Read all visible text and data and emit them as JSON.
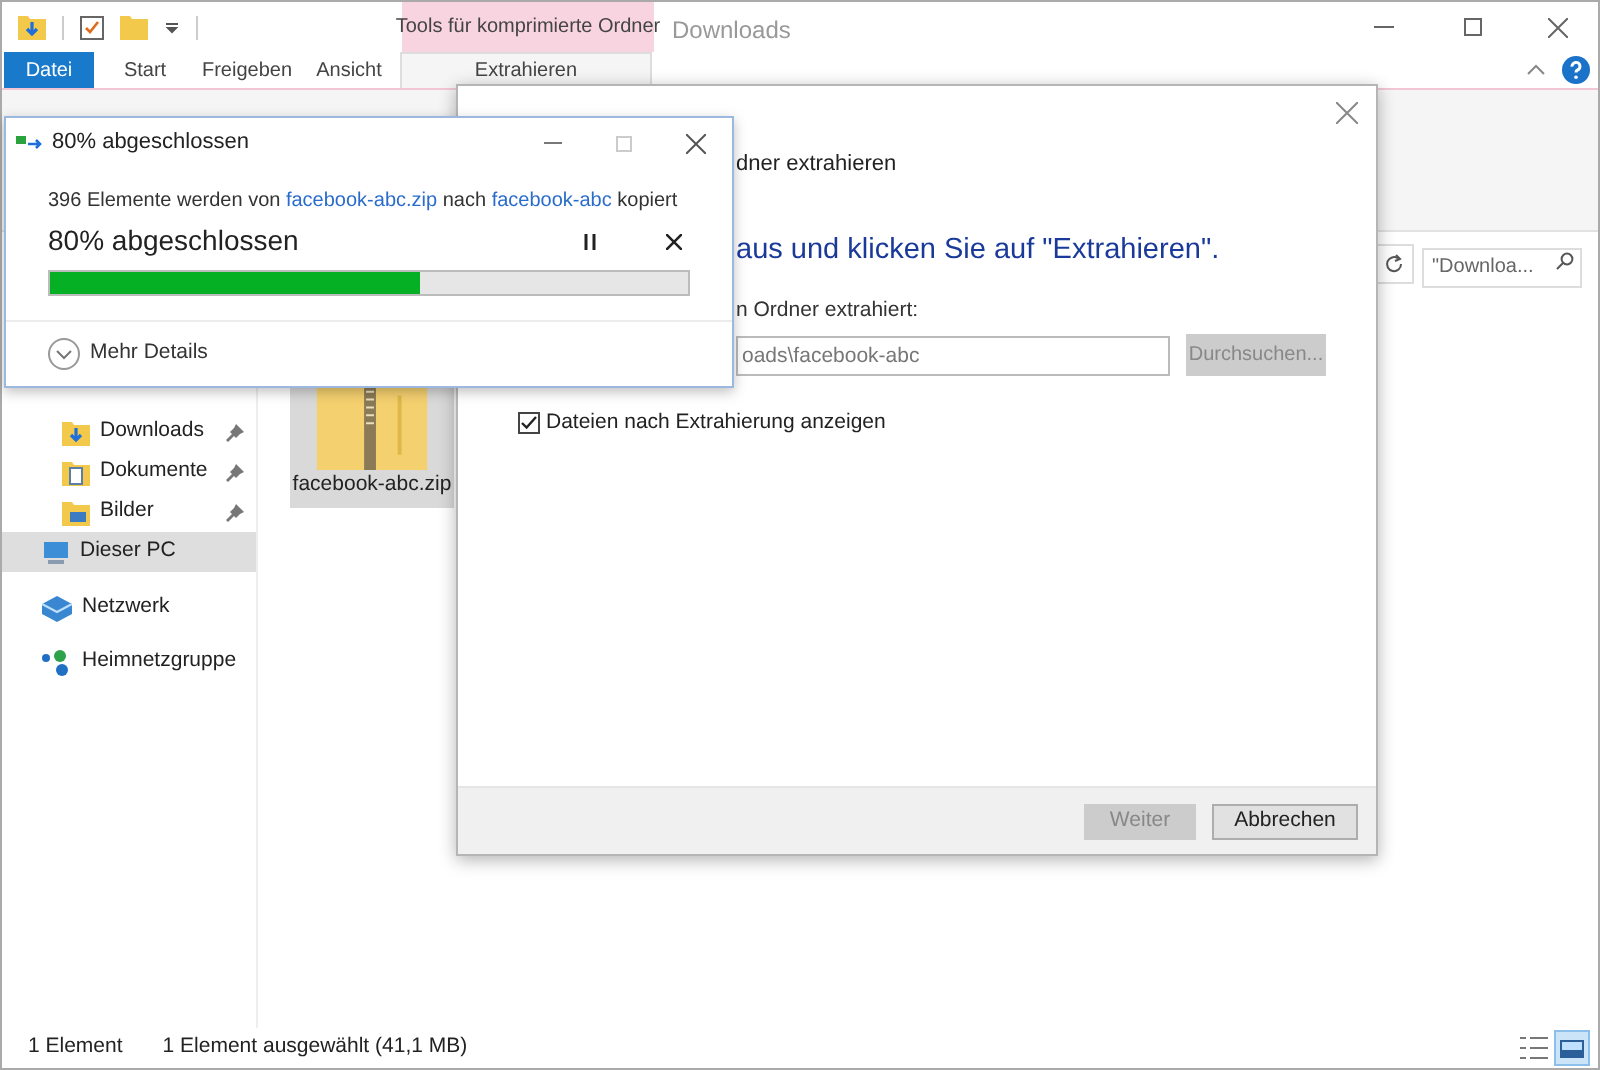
{
  "explorer": {
    "title": "Downloads",
    "contextual_group": "Tools für komprimierte Ordner",
    "ribbon_tabs": [
      {
        "label": "Datei",
        "kind": "file",
        "selected": false
      },
      {
        "label": "Start",
        "kind": "tab",
        "selected": false
      },
      {
        "label": "Freigeben",
        "kind": "tab",
        "selected": false
      },
      {
        "label": "Ansicht",
        "kind": "tab",
        "selected": false
      },
      {
        "label": "Extrahieren",
        "kind": "tab",
        "selected": true
      }
    ],
    "search": {
      "placeholder": "\"Downloa..."
    },
    "sidebar": [
      {
        "label": "Downloads",
        "kind": "downloads",
        "pinned": true,
        "selected": false
      },
      {
        "label": "Dokumente",
        "kind": "documents",
        "pinned": true,
        "selected": false
      },
      {
        "label": "Bilder",
        "kind": "pictures",
        "pinned": true,
        "selected": false
      },
      {
        "label": "Dieser PC",
        "kind": "pc",
        "pinned": false,
        "selected": true
      },
      {
        "label": "Netzwerk",
        "kind": "network",
        "pinned": false,
        "selected": false
      },
      {
        "label": "Heimnetzgruppe",
        "kind": "homegroup",
        "pinned": false,
        "selected": false
      }
    ],
    "files": [
      {
        "name": "facebook-abc.zip",
        "selected": true
      }
    ],
    "status_bar": {
      "count": "1 Element",
      "selection": "1 Element ausgewählt (41,1 MB)"
    }
  },
  "extract_dialog": {
    "title": "dner extrahieren",
    "heading": "aus und klicken Sie auf \"Extrahieren\".",
    "destination_label": "n Ordner extrahiert:",
    "destination_value": "oads\\facebook-abc",
    "browse_button": {
      "label": "Durchsuchen...",
      "disabled": true
    },
    "show_files": {
      "label": "Dateien nach Extrahierung anzeigen",
      "checked": true
    },
    "buttons": [
      {
        "label": "Weiter",
        "disabled": true
      },
      {
        "label": "Abbrechen",
        "disabled": false
      }
    ]
  },
  "progress_dialog": {
    "title": "80% abgeschlossen",
    "message": [
      {
        "text": "396 Elemente werden von ",
        "kind": "text"
      },
      {
        "text": "facebook-abc.zip",
        "kind": "link"
      },
      {
        "text": " nach ",
        "kind": "text"
      },
      {
        "text": "facebook-abc",
        "kind": "link"
      },
      {
        "text": " kopiert",
        "kind": "text"
      }
    ],
    "status": "80% abgeschlossen",
    "level": 0.58,
    "details": "Mehr Details"
  }
}
